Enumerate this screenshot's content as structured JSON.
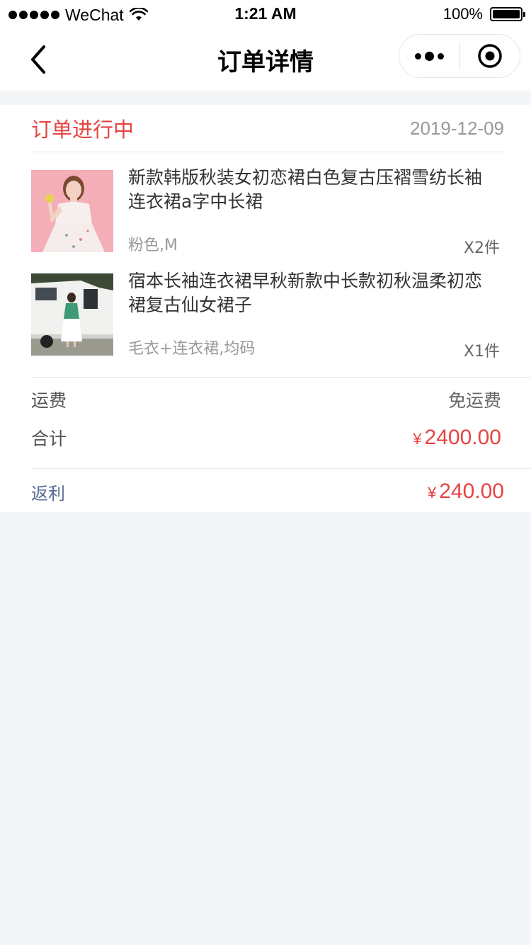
{
  "status_bar": {
    "carrier": "WeChat",
    "time": "1:21 AM",
    "battery": "100%",
    "signal_icon": "signal-dots-icon",
    "wifi_icon": "wifi-icon",
    "battery_level": 1.0
  },
  "nav": {
    "title": "订单详情",
    "back_icon": "chevron-left-icon",
    "more_icon": "more-dots-icon",
    "close_icon": "target-circle-icon"
  },
  "order": {
    "status": "订单进行中",
    "date": "2019-12-09"
  },
  "products": [
    {
      "title": "新款韩版秋装女初恋裙白色复古压褶雪纺长袖连衣裙a字中长裙",
      "spec": "粉色,M",
      "qty": "X2件"
    },
    {
      "title": "宿本长袖连衣裙早秋新款中长款初秋温柔初恋裙复古仙女裙子",
      "spec": "毛衣+连衣裙,均码",
      "qty": "X1件"
    }
  ],
  "summary": {
    "shipping_label": "运费",
    "shipping_value": "免运费",
    "total_label": "合计",
    "total_currency": "¥",
    "total_value": "2400.00",
    "rebate_label": "返利",
    "rebate_currency": "¥",
    "rebate_value": "240.00"
  },
  "colors": {
    "accent_red": "#e64340",
    "link_blue": "#576b95",
    "page_bg": "#f4f5f7"
  }
}
